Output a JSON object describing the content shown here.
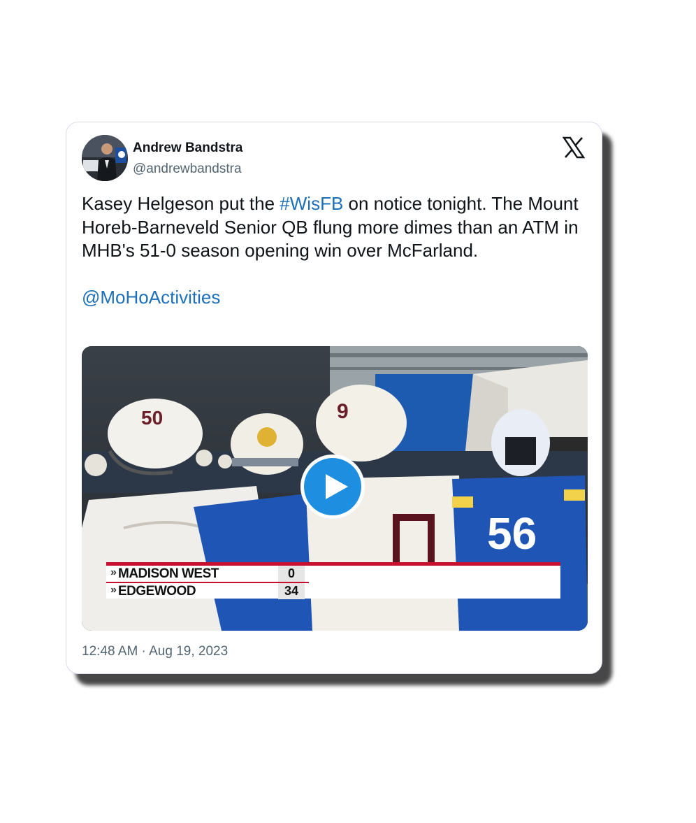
{
  "author": {
    "name": "Andrew Bandstra",
    "handle": "@andrewbandstra"
  },
  "platform_icon": "x-logo-icon",
  "tweet": {
    "text_before": "Kasey Helgeson put the ",
    "hashtag": "#WisFB",
    "text_after": " on notice tonight. The Mount Horeb-Barneveld Senior QB flung more dimes than an ATM in MHB's 51-0 season opening win over McFarland.",
    "mention": "@MoHoActivities"
  },
  "media": {
    "type": "video",
    "play_icon": "play-icon",
    "scoreboard": {
      "rows": [
        {
          "marker": "»",
          "team": "MADISON WEST",
          "score": "0"
        },
        {
          "marker": "»",
          "team": "EDGEWOOD",
          "score": "34"
        }
      ]
    },
    "jersey_numbers": {
      "left_helmet": "50",
      "center_helmet": "9",
      "right_jersey": "56"
    }
  },
  "timestamp": "12:48 AM · Aug 19, 2023",
  "colors": {
    "link": "#1d70b8",
    "play_button": "#1d8ee0",
    "scoreboard_accent": "#c8102e",
    "card_border": "#dcd9ec"
  }
}
